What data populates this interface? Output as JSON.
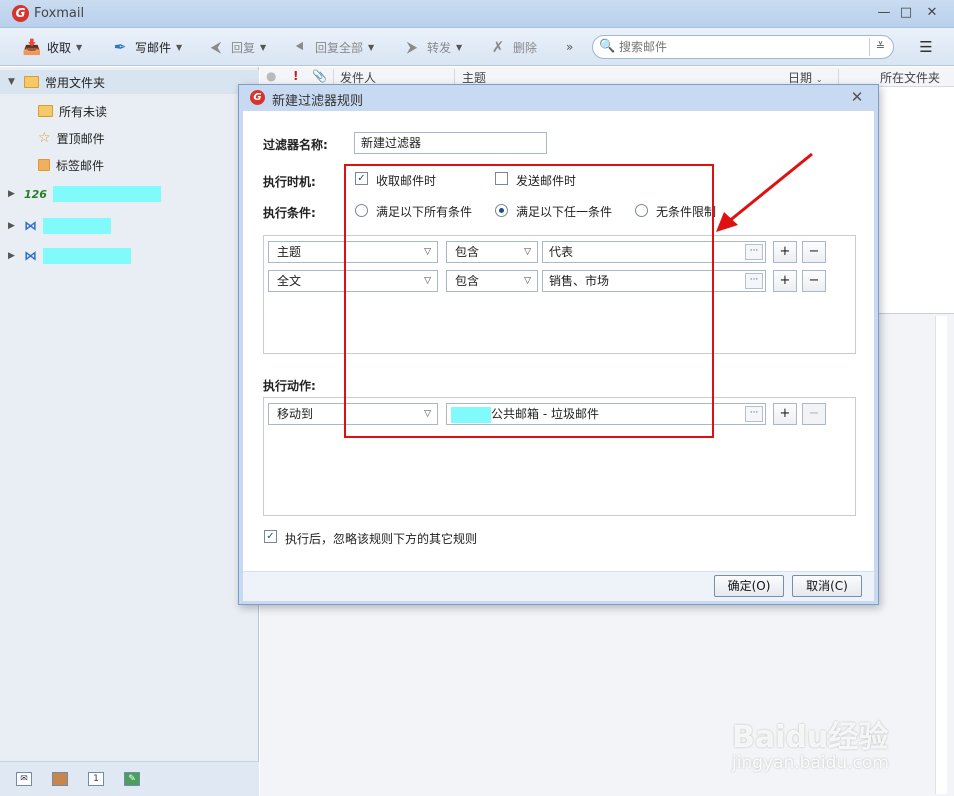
{
  "app": {
    "title": "Foxmail",
    "logo_letter": "G"
  },
  "window_controls": {
    "minimize": "—",
    "maximize": "□",
    "close": "✕"
  },
  "toolbar": {
    "receive": "收取",
    "compose": "写邮件",
    "reply": "回复",
    "reply_all": "回复全部",
    "forward": "转发",
    "delete": "删除",
    "more": "»"
  },
  "search": {
    "placeholder": "搜索邮件"
  },
  "sidebar": {
    "header": "常用文件夹",
    "items": [
      {
        "label": "所有未读",
        "icon": "folder-icon"
      },
      {
        "label": "置顶邮件",
        "icon": "star-icon"
      },
      {
        "label": "标签邮件",
        "icon": "tag-folder-icon"
      }
    ],
    "accounts": [
      {
        "icon_text": "126",
        "icon": "126-mail-icon"
      },
      {
        "icon_text": "⋈",
        "icon": "exchange-icon"
      },
      {
        "icon_text": "⋈",
        "icon": "exchange-icon"
      }
    ]
  },
  "mail_list": {
    "columns": {
      "sender": "发件人",
      "subject": "主题",
      "date": "日期",
      "folder": "所在文件夹"
    }
  },
  "dialog": {
    "title": "新建过滤器规则",
    "name_label": "过滤器名称:",
    "name_value": "新建过滤器",
    "timing_label": "执行时机:",
    "timing_options": [
      {
        "label": "收取邮件时",
        "checked": true
      },
      {
        "label": "发送邮件时",
        "checked": false
      }
    ],
    "condition_label": "执行条件:",
    "condition_options": [
      {
        "label": "满足以下所有条件",
        "selected": false
      },
      {
        "label": "满足以下任一条件",
        "selected": true
      },
      {
        "label": "无条件限制",
        "selected": false
      }
    ],
    "conditions": [
      {
        "field": "主题",
        "operator": "包含",
        "value": "代表"
      },
      {
        "field": "全文",
        "operator": "包含",
        "value": "销售、市场"
      }
    ],
    "action_label": "执行动作:",
    "actions": [
      {
        "action": "移动到",
        "target": "公共邮箱 - 垃圾邮件"
      }
    ],
    "ignore_label": "执行后，忽略该规则下方的其它规则",
    "ignore_checked": true,
    "ok": "确定(O)",
    "cancel": "取消(C)"
  },
  "watermark": {
    "brand": "Baidu经验",
    "url": "jingyan.baidu.com"
  },
  "colors": {
    "annotation": "#e01010",
    "redaction": "#80fafa",
    "accent": "#1e4d8c"
  }
}
